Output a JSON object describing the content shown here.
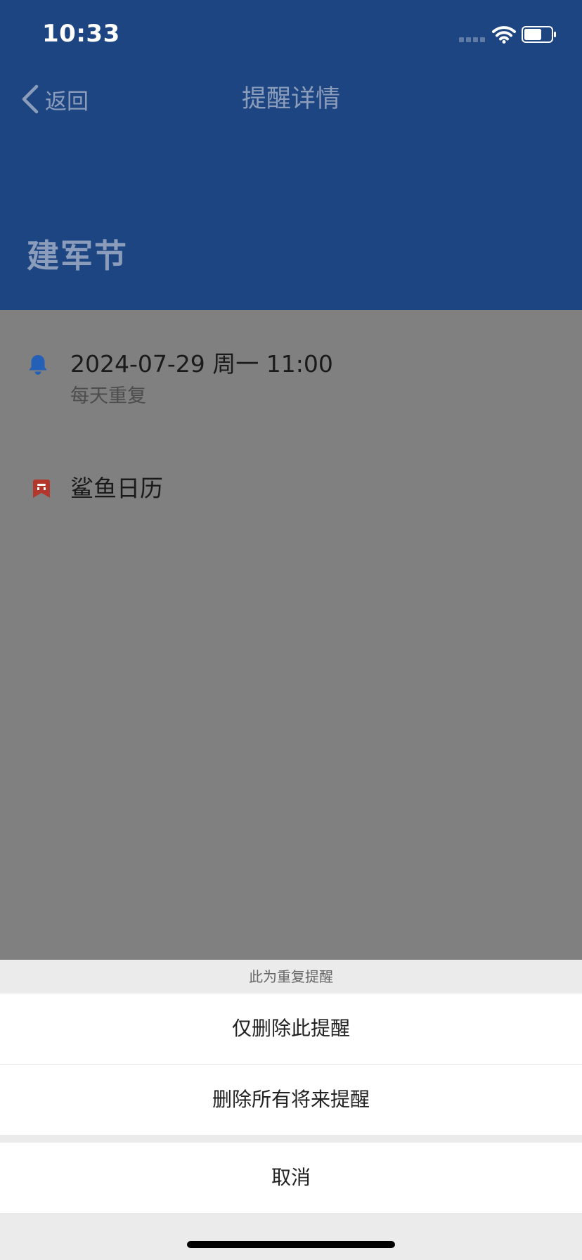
{
  "status_bar": {
    "time": "10:33"
  },
  "nav": {
    "back_label": "返回",
    "title": "提醒详情"
  },
  "event": {
    "title": "建军节"
  },
  "details": {
    "datetime": "2024-07-29 周一 11:00",
    "repeat": "每天重复",
    "calendar": "鲨鱼日历"
  },
  "action_sheet": {
    "title": "此为重复提醒",
    "delete_this": "仅删除此提醒",
    "delete_future": "删除所有将来提醒",
    "cancel": "取消"
  },
  "colors": {
    "header_bg": "#1c4581",
    "overlay_bg": "#808080",
    "bell_icon": "#2460b5",
    "calendar_icon": "#b3372b",
    "sheet_bg": "#ebebeb"
  },
  "icons": {
    "back": "chevron-left-icon",
    "reminder": "bell-icon",
    "calendar": "bookmark-icon",
    "wifi": "wifi-icon",
    "battery": "battery-icon",
    "signal": "signal-icon"
  }
}
